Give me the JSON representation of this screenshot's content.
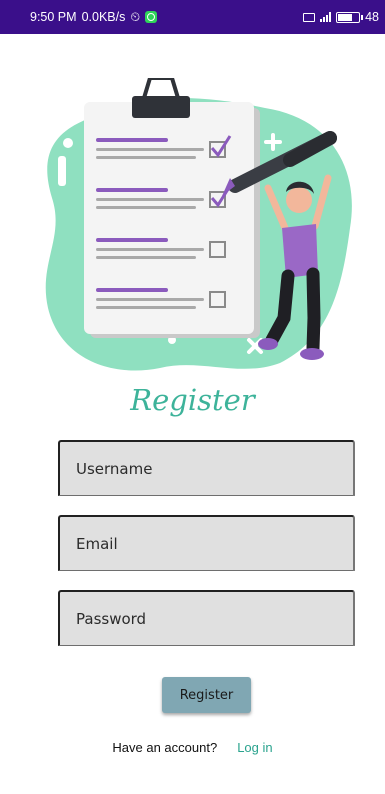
{
  "status_bar": {
    "time": "9:50 PM",
    "network_speed": "0.0KB/s",
    "battery_level": "48"
  },
  "screen": {
    "title": "Register",
    "username_placeholder": "Username",
    "email_placeholder": "Email",
    "password_placeholder": "Password",
    "register_button_label": "Register",
    "have_account_text": "Have an account?",
    "login_link_label": "Log in"
  },
  "colors": {
    "status_bar": "#3a0f8a",
    "accent": "#3db39a",
    "blob": "#8fe0c0",
    "button": "#80a7b3",
    "field_background": "#e0e0e0"
  },
  "icons": {
    "illustration": "checklist-illustration",
    "status_alarm": "alarm-icon",
    "status_whatsapp": "whatsapp-icon"
  }
}
